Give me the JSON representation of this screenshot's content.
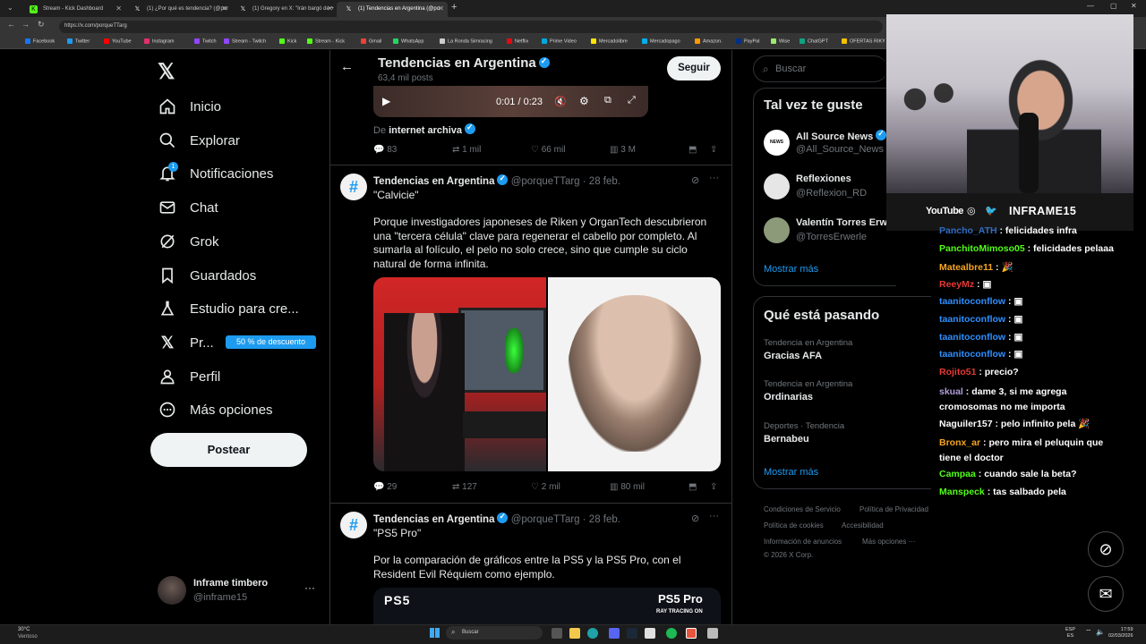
{
  "browser": {
    "tabs": [
      {
        "title": "Stream - Kick Dashboard",
        "favicon_color": "#53fc18",
        "favicon_glyph": "K"
      },
      {
        "title": "(1) ¿Por qué es tendencia? (@por",
        "favicon_color": "#000000",
        "favicon_glyph": "X"
      },
      {
        "title": "(1) Gregory en X: \"Irán bargó de +",
        "favicon_color": "#000000",
        "favicon_glyph": "X"
      },
      {
        "title": "(1) Tendencias en Argentina (@po",
        "favicon_color": "#000000",
        "favicon_glyph": "X"
      }
    ],
    "url": "https://x.com/porqueTTarg",
    "bookmarks": [
      {
        "label": "Facebook",
        "color": "#1877f2"
      },
      {
        "label": "Twitter",
        "color": "#1d9bf0"
      },
      {
        "label": "YouTube",
        "color": "#ff0000"
      },
      {
        "label": "Instagram",
        "color": "#e1306c"
      },
      {
        "label": "Twitch",
        "color": "#9146ff"
      },
      {
        "label": "Stream - Twitch",
        "color": "#9146ff"
      },
      {
        "label": "Kick",
        "color": "#53fc18"
      },
      {
        "label": "Stream - Kick",
        "color": "#53fc18"
      },
      {
        "label": "Gmail",
        "color": "#ea4335"
      },
      {
        "label": "WhatsApp",
        "color": "#25d366"
      },
      {
        "label": "La Ronda Simracing",
        "color": "#cccccc"
      },
      {
        "label": "Netflix",
        "color": "#e50914"
      },
      {
        "label": "Prime Video",
        "color": "#00a8e1"
      },
      {
        "label": "Mercadolibre",
        "color": "#ffe600"
      },
      {
        "label": "Mercadopago",
        "color": "#00b1ea"
      },
      {
        "label": "Amazon.",
        "color": "#ff9900"
      },
      {
        "label": "PayPal",
        "color": "#003087"
      },
      {
        "label": "Wise",
        "color": "#9fe870"
      },
      {
        "label": "ChatGPT",
        "color": "#10a37f"
      },
      {
        "label": "OFERTAS RIKY S",
        "color": "#f2c200"
      }
    ]
  },
  "sidebar": {
    "items": [
      {
        "label": "Inicio",
        "icon": "home-icon"
      },
      {
        "label": "Explorar",
        "icon": "search-icon"
      },
      {
        "label": "Notificaciones",
        "icon": "bell-icon",
        "badge": "1"
      },
      {
        "label": "Chat",
        "icon": "mail-icon"
      },
      {
        "label": "Grok",
        "icon": "grok-icon"
      },
      {
        "label": "Guardados",
        "icon": "bookmark-icon"
      },
      {
        "label": "Estudio para cre...",
        "icon": "flask-icon"
      },
      {
        "label": "Pr...",
        "icon": "x-premium-icon"
      },
      {
        "label": "Perfil",
        "icon": "person-icon"
      },
      {
        "label": "Más opciones",
        "icon": "more-circle-icon"
      }
    ],
    "promo_badge": "50 % de descuento",
    "post_button": "Postear",
    "account": {
      "name": "Inframe timbero",
      "handle": "@inframe15"
    }
  },
  "header": {
    "title": "Tendencias en Argentina",
    "posts_count": "63,4 mil posts",
    "follow_button": "Seguir"
  },
  "video_post": {
    "time": "0:01 / 0:23",
    "source_prefix": "De",
    "source_name": "internet archiva",
    "stats": {
      "replies": "83",
      "reposts": "1 mil",
      "likes": "66 mil",
      "views": "3 M"
    }
  },
  "posts": [
    {
      "author": "Tendencias en Argentina",
      "handle": "@porqueTTarg",
      "date": "· 28 feb.",
      "headline": "\"Calvicie\"",
      "body": "Porque investigadores japoneses de Riken y OrganTech descubrieron una \"tercera célula\" clave para regenerar el cabello por completo. Al sumarla al folículo, el pelo no solo crece, sino que cumple su ciclo natural de forma infinita.",
      "stats": {
        "replies": "29",
        "reposts": "127",
        "likes": "2 mil",
        "views": "80 mil"
      }
    },
    {
      "author": "Tendencias en Argentina",
      "handle": "@porqueTTarg",
      "date": "· 28 feb.",
      "headline": "\"PS5 Pro\"",
      "body": "Por la comparación de gráficos entre la PS5 y la PS5 Pro, con el Resident Evil Réquiem como ejemplo.",
      "media_left": "PS5",
      "media_right": "PS5 Pro",
      "media_right_sub": "RAY TRACING ON"
    }
  ],
  "right": {
    "search_placeholder": "Buscar",
    "suggest_title": "Tal vez te guste",
    "suggestions": [
      {
        "name": "All Source News",
        "handle": "@All_Source_News",
        "verified": true
      },
      {
        "name": "Reflexiones",
        "handle": "@Reflexion_RD",
        "verified": false
      },
      {
        "name": "Valentín Torres Erw",
        "handle": "@TorresErwerle",
        "verified": false
      }
    ],
    "show_more": "Mostrar más",
    "trends_title": "Qué está pasando",
    "trends": [
      {
        "meta": "Tendencia en Argentina",
        "name": "Gracias AFA"
      },
      {
        "meta": "Tendencia en Argentina",
        "name": "Ordinarias"
      },
      {
        "meta": "Deportes · Tendencia",
        "name": "Bernabeu"
      }
    ],
    "trends_more": "Mostrar más",
    "footer": [
      "Condiciones de Servicio",
      "Política de Privacidad",
      "Política de cookies",
      "Accesibilidad",
      "Información de anuncios",
      "Más opciones ···",
      "© 2026 X Corp."
    ]
  },
  "stream_overlay": {
    "youtube": "YouTube",
    "channel": "INFRAME15"
  },
  "chat": [
    {
      "user": "Pancho_ATH",
      "color": "#2e6cc4",
      "msg": "felicidades infra"
    },
    {
      "user": "PanchitoMimoso05",
      "color": "#53fc18",
      "msg": "felicidades pelaaa"
    },
    {
      "user": "Matealbre11",
      "color": "#f5a623",
      "msg": "🎉"
    },
    {
      "user": "ReeyMz",
      "color": "#e53935",
      "msg": "▣"
    },
    {
      "user": "taanitoconflow",
      "color": "#2e8fff",
      "msg": "▣"
    },
    {
      "user": "taanitoconflow",
      "color": "#2e8fff",
      "msg": "▣"
    },
    {
      "user": "taanitoconflow",
      "color": "#2e8fff",
      "msg": "▣"
    },
    {
      "user": "taanitoconflow",
      "color": "#2e8fff",
      "msg": "▣"
    },
    {
      "user": "Rojito51",
      "color": "#e53935",
      "msg": "precio?"
    },
    {
      "user": "skual",
      "color": "#b39ddb",
      "msg": "dame 3, si me agrega cromosomas no me importa"
    },
    {
      "user": "Naguiler157",
      "color": "#ffffff",
      "msg": "pelo infinito pela 🎉"
    },
    {
      "user": "Bronx_ar",
      "color": "#f5a623",
      "msg": "pero mira el peluquin que tiene el doctor"
    },
    {
      "user": "Campaa",
      "color": "#53fc18",
      "msg": "cuando sale la beta?"
    },
    {
      "user": "Manspeck",
      "color": "#53fc18",
      "msg": "tas salbado pela"
    }
  ],
  "taskbar": {
    "weather_temp": "30°C",
    "weather_text": "Ventoso",
    "search": "Buscar",
    "lang": "ESP",
    "lang_sub": "ES",
    "time": "17:59",
    "date": "02/03/2026"
  }
}
